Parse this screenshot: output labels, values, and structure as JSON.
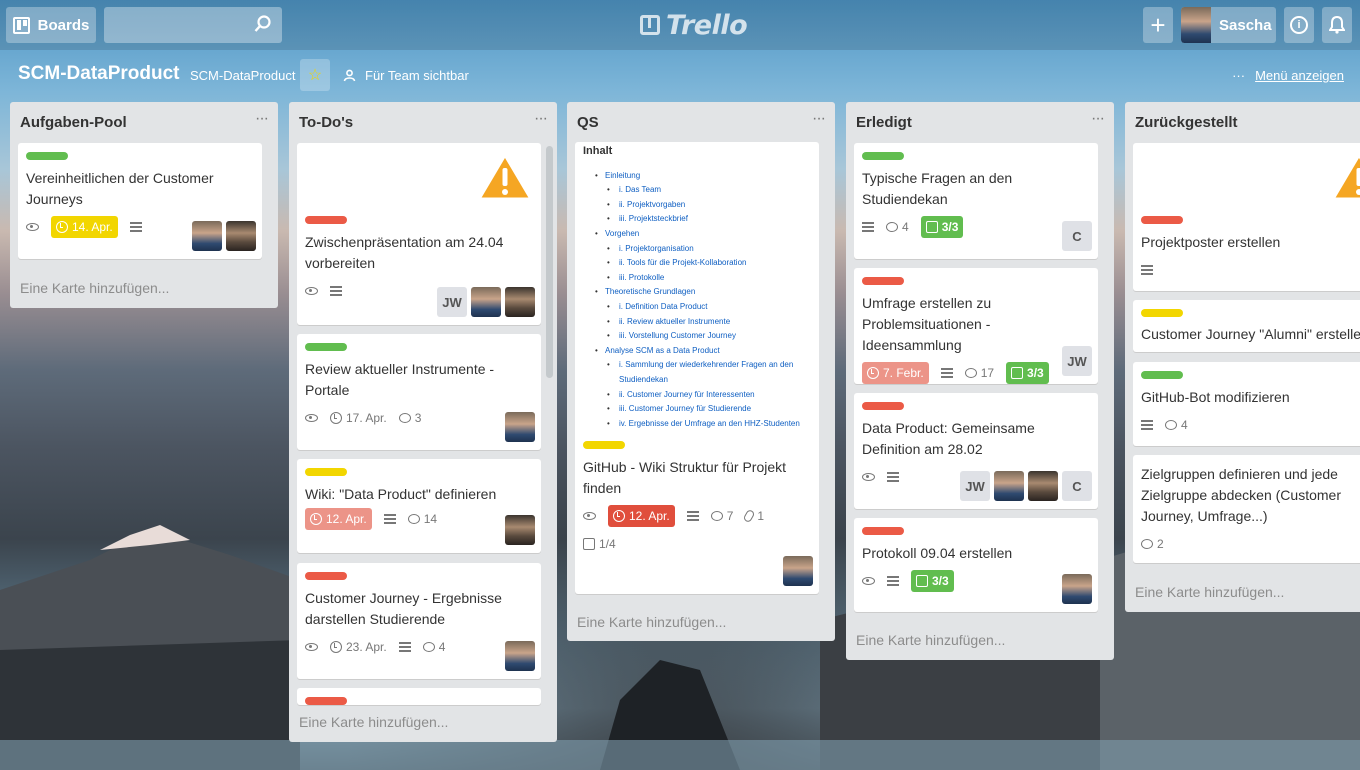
{
  "topbar": {
    "boards_label": "Boards",
    "logo_text": "Trello",
    "plus_label": "+",
    "user_name": "Sascha"
  },
  "board": {
    "title": "SCM-DataProduct",
    "team": "SCM-DataProduct",
    "visibility": "Für Team sichtbar",
    "menu_label": "Menü anzeigen",
    "menu_dots": "···"
  },
  "add_card_label": "Eine Karte hinzufügen...",
  "lists": [
    {
      "title": "Aufgaben-Pool",
      "cards": [
        {
          "title": "Vereinheitlichen der Customer Journeys",
          "due": "14. Apr."
        }
      ]
    },
    {
      "title": "To-Do's",
      "cards": [
        {
          "title": "Zwischenpräsentation am 24.04 vorbereiten",
          "member": "JW"
        },
        {
          "title": "Review aktueller Instrumente - Portale",
          "due": "17. Apr.",
          "comments": "3"
        },
        {
          "title": "Wiki: \"Data Product\" definieren",
          "due": "12. Apr.",
          "comments": "14"
        },
        {
          "title": "Customer Journey - Ergebnisse darstellen Studierende",
          "due": "23. Apr.",
          "comments": "4"
        }
      ]
    },
    {
      "title": "QS",
      "cards": [
        {
          "toc_title": "Inhalt",
          "toc": [
            {
              "text": "Einleitung",
              "level": 1
            },
            {
              "text": "i. Das Team",
              "level": 2
            },
            {
              "text": "ii. Projektvorgaben",
              "level": 2
            },
            {
              "text": "iii. Projektsteckbrief",
              "level": 2
            },
            {
              "text": "Vorgehen",
              "level": 1
            },
            {
              "text": "i. Projektorganisation",
              "level": 2
            },
            {
              "text": "ii. Tools für die Projekt-Kollaboration",
              "level": 2
            },
            {
              "text": "iii. Protokolle",
              "level": 2
            },
            {
              "text": "Theoretische Grundlagen",
              "level": 1
            },
            {
              "text": "i. Definition Data Product",
              "level": 2
            },
            {
              "text": "ii. Review aktueller Instrumente",
              "level": 2
            },
            {
              "text": "iii. Vorstellung Customer Journey",
              "level": 2
            },
            {
              "text": "Analyse SCM as a Data Product",
              "level": 1
            },
            {
              "text": "i. Sammlung der wiederkehrender Fragen an den Studiendekan",
              "level": 2
            },
            {
              "text": "ii. Customer Journey für Interessenten",
              "level": 2
            },
            {
              "text": "iii. Customer Journey für Studierende",
              "level": 2
            },
            {
              "text": "iv. Ergebnisse der Umfrage an den HHZ-Studenten",
              "level": 2
            }
          ],
          "title": "GitHub - Wiki Struktur für Projekt finden",
          "due": "12. Apr.",
          "comments": "7",
          "attachments": "1",
          "checklist": "1/4"
        }
      ]
    },
    {
      "title": "Erledigt",
      "cards": [
        {
          "title": "Typische Fragen an den Studiendekan",
          "comments": "4",
          "checklist": "3/3",
          "member": "C"
        },
        {
          "title": "Umfrage erstellen zu Problemsituationen - Ideensammlung",
          "due": "7. Febr.",
          "comments": "17",
          "checklist": "3/3",
          "member": "JW"
        },
        {
          "title": "Data Product: Gemeinsame Definition am 28.02",
          "members": [
            "JW",
            "C"
          ]
        },
        {
          "title": "Protokoll 09.04 erstellen",
          "checklist": "3/3"
        }
      ]
    },
    {
      "title": "Zurückgestellt",
      "cards": [
        {
          "title": "Projektposter erstellen"
        },
        {
          "title": "Customer Journey \"Alumni\" erstellen"
        },
        {
          "title": "GitHub-Bot modifizieren",
          "comments": "4"
        },
        {
          "title": "Zielgruppen definieren und jede Zielgruppe abdecken (Customer Journey, Umfrage...)",
          "comments": "2"
        }
      ]
    }
  ],
  "colors": {
    "label_green": "#61bd4f",
    "label_red": "#eb5a46",
    "label_yellow": "#f2d600",
    "list_bg": "#e2e4e6"
  }
}
